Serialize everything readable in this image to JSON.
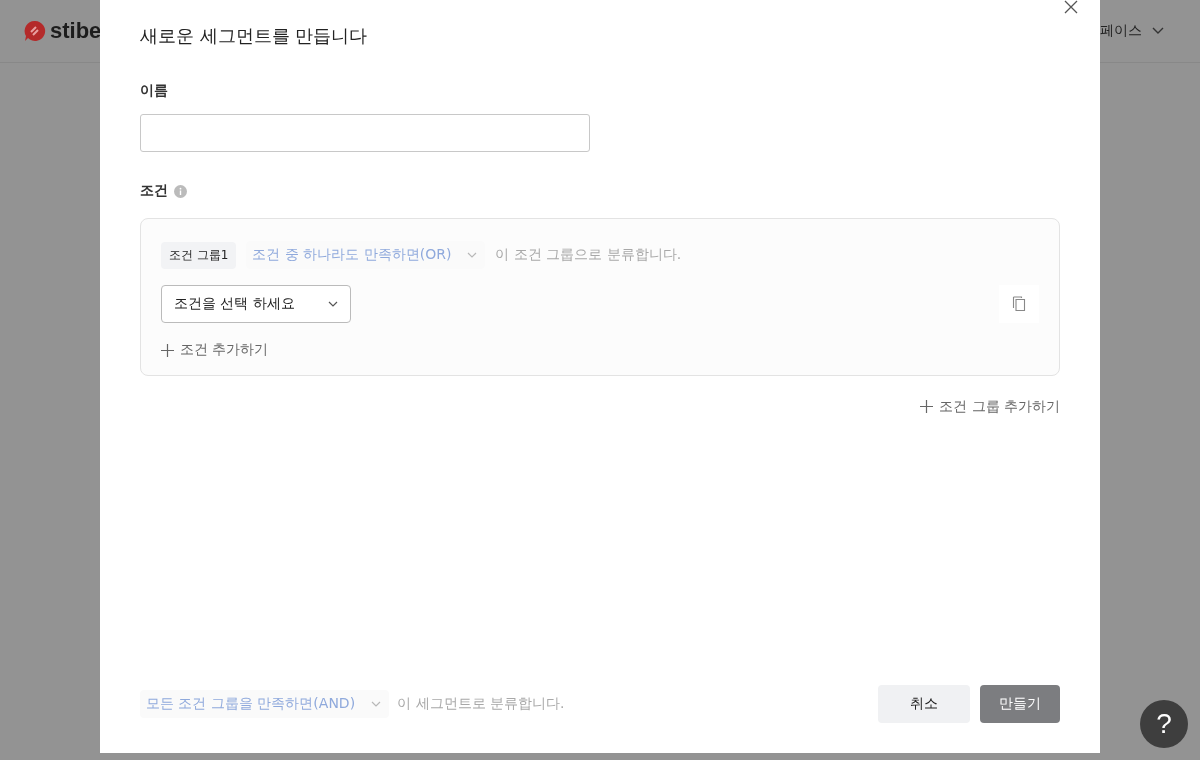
{
  "background": {
    "logo": "stibe",
    "workspace": "페이스"
  },
  "dialog": {
    "title": "새로운 세그먼트를 만듭니다",
    "name_field": {
      "label": "이름"
    },
    "conditions_label": "조건",
    "groups": [
      {
        "tag": "조건 그룹1",
        "match": {
          "value": "조건 중 하나라도 만족하면(OR)",
          "disabled": true
        },
        "suffix": "이 조건 그룹으로 분류합니다.",
        "conditions": [
          {
            "placeholder": "조건을 선택 하세요"
          }
        ],
        "add_condition": "조건 추가하기"
      }
    ],
    "add_group": "조건 그룹 추가하기",
    "footer": {
      "match": {
        "value": "모든 조건 그룹을 만족하면(AND)",
        "disabled": true
      },
      "suffix": "이 세그먼트로 분류합니다.",
      "buttons": [
        {
          "label": "취소",
          "kind": "secondary",
          "disabled": false
        },
        {
          "label": "만들기",
          "kind": "primary",
          "disabled": true
        }
      ]
    }
  },
  "help": "?"
}
